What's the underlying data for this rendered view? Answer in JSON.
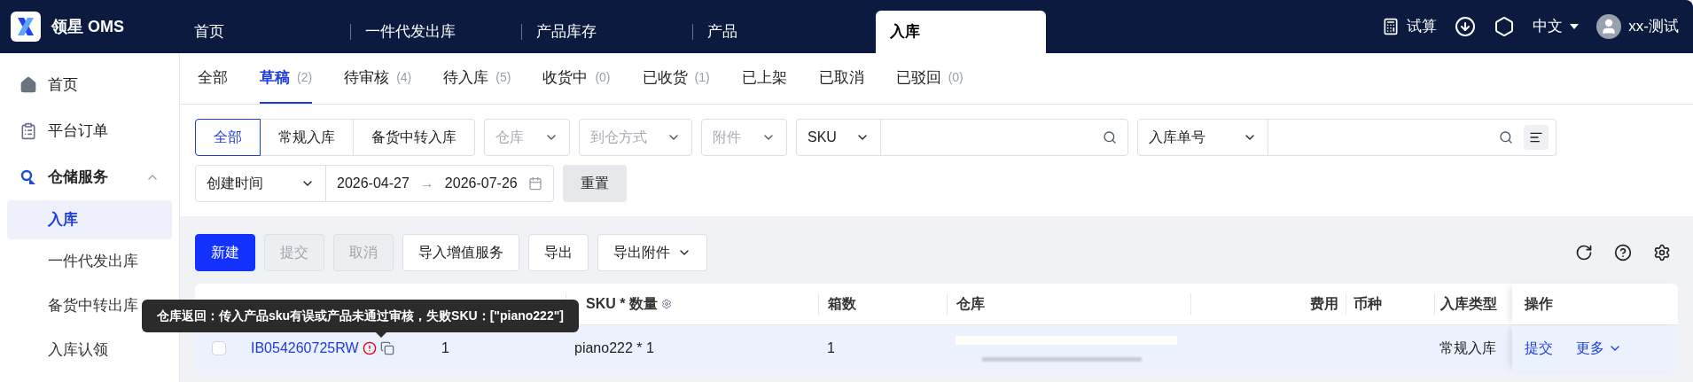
{
  "app": {
    "logo_text": "领星 OMS"
  },
  "top_nav": [
    {
      "label": "首页",
      "selected": false
    },
    {
      "label": "一件代发出库",
      "selected": false
    },
    {
      "label": "产品库存",
      "selected": false
    },
    {
      "label": "产品",
      "selected": false
    },
    {
      "label": "入库",
      "selected": true
    }
  ],
  "header_actions": {
    "calc": "试算",
    "language": "中文",
    "user": "xx-测试"
  },
  "sidebar": [
    {
      "label": "首页",
      "kind": "home"
    },
    {
      "label": "平台订单",
      "kind": "clipboard"
    },
    {
      "label": "仓储服务",
      "kind": "warehouse",
      "expanded": true,
      "children": [
        {
          "label": "入库",
          "selected": true
        },
        {
          "label": "一件代发出库",
          "selected": false
        },
        {
          "label": "备货中转出库",
          "selected": false
        },
        {
          "label": "入库认领",
          "selected": false
        }
      ]
    }
  ],
  "status_tabs": [
    {
      "label": "全部",
      "selected": false
    },
    {
      "label": "草稿",
      "count": "(2)",
      "selected": true
    },
    {
      "label": "待审核",
      "count": "(4)",
      "selected": false
    },
    {
      "label": "待入库",
      "count": "(5)",
      "selected": false
    },
    {
      "label": "收货中",
      "count": "(0)",
      "selected": false
    },
    {
      "label": "已收货",
      "count": "(1)",
      "selected": false
    },
    {
      "label": "已上架",
      "selected": false
    },
    {
      "label": "已取消",
      "selected": false
    },
    {
      "label": "已驳回",
      "count": "(0)",
      "selected": false
    }
  ],
  "filters": {
    "type_segments": [
      {
        "label": "全部",
        "selected": true
      },
      {
        "label": "常规入库",
        "selected": false
      },
      {
        "label": "备货中转入库",
        "selected": false
      }
    ],
    "selects": [
      {
        "placeholder": "仓库"
      },
      {
        "placeholder": "到仓方式"
      },
      {
        "placeholder": "附件"
      }
    ],
    "sku_search": {
      "field": "SKU"
    },
    "order_search": {
      "field": "入库单号"
    },
    "date": {
      "field": "创建时间",
      "start": "2026-04-27",
      "separator": "→",
      "end": "2026-07-26"
    },
    "reset": "重置"
  },
  "toolbar": [
    {
      "label": "新建",
      "kind": "primary",
      "disabled": false
    },
    {
      "label": "提交",
      "kind": "default",
      "disabled": true
    },
    {
      "label": "取消",
      "kind": "default",
      "disabled": true
    },
    {
      "label": "导入增值服务",
      "kind": "default",
      "disabled": false
    },
    {
      "label": "导出",
      "kind": "default",
      "disabled": false
    },
    {
      "label": "导出附件",
      "kind": "dropdown",
      "disabled": false
    }
  ],
  "table": {
    "columns": [
      "SKU * 数量",
      "箱数",
      "仓库",
      "费用",
      "币种",
      "入库类型",
      "操作"
    ],
    "rows": [
      {
        "checked": false,
        "order_no": "IB054260725RW",
        "product_qty": "1",
        "sku_qty": "piano222 * 1",
        "boxes": "1",
        "type": "常规入库",
        "actions": [
          "提交",
          "更多"
        ]
      }
    ]
  },
  "tooltip": {
    "text": "仓库返回：传入产品sku有误或产品未通过审核，失败SKU：[\"piano222\"]"
  }
}
